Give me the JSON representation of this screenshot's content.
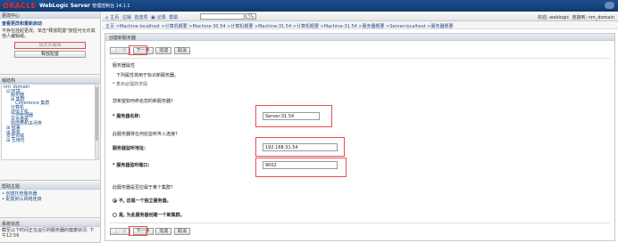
{
  "header": {
    "logo": "ORACLE",
    "product": "WebLogic Server",
    "product_sub": "管理控制台 14.1.1"
  },
  "change_center": {
    "title": "更改中心",
    "subtitle": "查看更改和重新启动",
    "text": "不存在挂起更改。单击\"释放配置\"按钮可允许其他人编辑域。",
    "lock_button": "锁定并编辑",
    "release_button": "释放配置"
  },
  "domain_structure": {
    "title": "域结构",
    "items": [
      {
        "label": "nm_domain",
        "level": 0
      },
      {
        "label": "⊟ 环境",
        "level": 1
      },
      {
        "label": "服务器",
        "level": 2
      },
      {
        "label": "⊞ 集群",
        "level": 2
      },
      {
        "label": "Coherence 集群",
        "level": 2
      },
      {
        "label": "计算机",
        "level": 2
      },
      {
        "label": "虚拟主机",
        "level": 2
      },
      {
        "label": "工作管理器",
        "level": 2
      },
      {
        "label": "并发模板",
        "level": 2
      },
      {
        "label": "启动类和关闭类",
        "level": 2
      },
      {
        "label": "⊞ 部署",
        "level": 1
      },
      {
        "label": "⊞ 服务",
        "level": 1
      },
      {
        "label": "安全领域",
        "level": 1
      },
      {
        "label": "⊞ 互用性",
        "level": 1
      }
    ]
  },
  "help": {
    "title": "帮助主题",
    "items": [
      "创建托管服务器",
      "配置默认网络连接"
    ]
  },
  "system_status": {
    "title": "系统状态",
    "text": "截至以下时间正在运行的服务器的健康状况: 下午12:56"
  },
  "toolbar": {
    "items": [
      "主页",
      "注销",
      "首选项",
      "记录",
      "帮助"
    ],
    "search_placeholder": "",
    "welcome": "欢迎, weblogic",
    "connected": "连接到: nm_domain"
  },
  "breadcrumb": "主页 >Machine-localhost >计算机概要 >Machine-30.54 >计算机概要 >Machine-31.54 >计算机概要 >Machine-31.54 >服务器概要 >Server-localhost >服务器概要",
  "form": {
    "title": "创建新服务器",
    "buttons": {
      "back": "上一步",
      "next": "下一步",
      "finish": "完成",
      "cancel": "取消"
    },
    "section_title": "服务器属性",
    "section_desc": "下列属性将用于标识新服务器。",
    "required_note": "* 表示必需的字段",
    "question_name": "您希望如何命名您的新服务器?",
    "label_name": "* 服务器名称:",
    "value_name": "Server-31.54",
    "question_listen": "此服务器将在何处监听传入连接?",
    "label_address": "服务器监听地址:",
    "value_address": "192.168.31.54",
    "label_port": "* 服务器监听端口:",
    "value_port": "9002",
    "question_cluster": "此服务器是否应属于某个集群?",
    "radio_standalone": "不, 这是一个独立服务器。",
    "radio_cluster": "是, 为此服务器创建一个新集群。"
  }
}
